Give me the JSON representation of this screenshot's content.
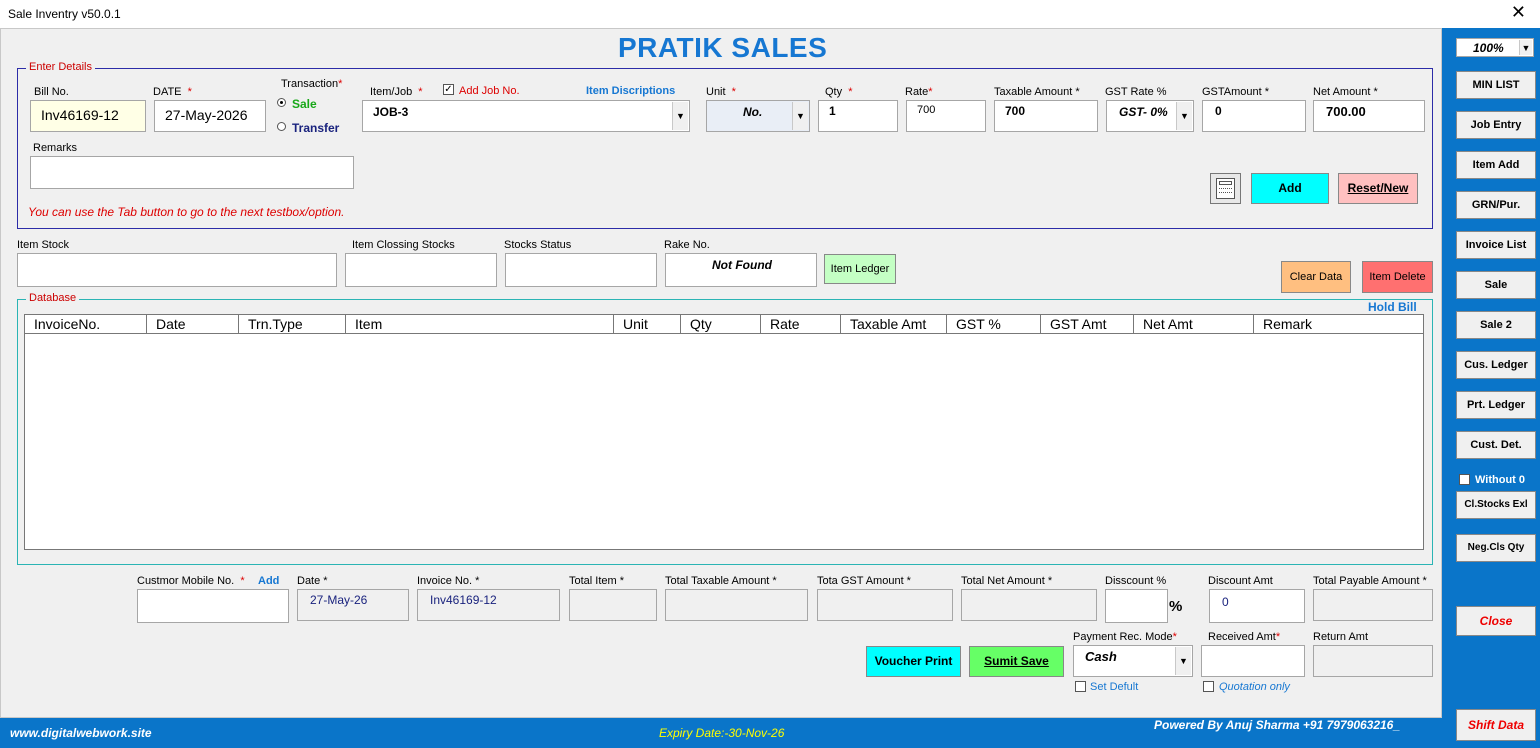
{
  "window": {
    "title": "Sale Inventry v50.0.1",
    "close": "✕"
  },
  "brand": "PRATIK SALES",
  "enter_details": {
    "legend": "Enter Details",
    "bill_no_label": "Bill No.",
    "bill_no": "Inv46169-12",
    "date_label": "DATE",
    "date": "27-May-2026",
    "transaction_label": "Transaction",
    "sale": "Sale",
    "transfer": "Transfer",
    "item_job_label": "Item/Job",
    "add_job_no": "Add Job No.",
    "item_descriptions": "Item Discriptions",
    "item_job_value": "JOB-3",
    "unit_label": "Unit",
    "unit_value": "No.",
    "qty_label": "Qty",
    "qty_value": "1",
    "rate_label": "Rate",
    "rate_value": "700",
    "taxable_label": "Taxable Amount *",
    "taxable_value": "700",
    "gst_rate_label": "GST Rate %",
    "gst_rate_value": "GST- 0%",
    "gst_amount_label": "GSTAmount *",
    "gst_amount_value": "0",
    "net_amount_label": "Net Amount *",
    "net_amount_value": "700.00",
    "remarks_label": "Remarks",
    "hint": "You can use the Tab button to go to the next testbox/option.",
    "add_button": "Add",
    "reset_button": "Reset/New"
  },
  "stock": {
    "item_stock_label": "Item Stock",
    "item_closing_label": "Item Clossing Stocks",
    "stocks_status_label": "Stocks Status",
    "rake_no_label": "Rake No.",
    "rake_no_value": "Not Found",
    "item_ledger_button": "Item Ledger",
    "clear_data_button": "Clear Data",
    "item_delete_button": "Item Delete"
  },
  "database": {
    "legend": "Database",
    "hold_bill": "Hold Bill",
    "columns": [
      "InvoiceNo.",
      "Date",
      "Trn.Type",
      "Item",
      "Unit",
      "Qty",
      "Rate",
      "Taxable  Amt",
      "GST  %",
      "GST Amt",
      "Net Amt",
      "Remark"
    ]
  },
  "summary": {
    "mobile_label": "Custmor Mobile No.",
    "mobile_add": "Add",
    "date_label": "Date *",
    "date_value": "27-May-26",
    "invoice_label": "Invoice No. *",
    "invoice_value": "Inv46169-12",
    "total_item_label": "Total Item *",
    "total_taxable_label": "Total Taxable Amount *",
    "total_gst_label": "Tota GST Amount *",
    "total_net_label": "Total Net Amount *",
    "discount_pct_label": "Disscount %",
    "pct_sign": "%",
    "discount_amt_label": "Discount Amt",
    "discount_amt_value": "0",
    "total_payable_label": "Total Payable Amount *",
    "payment_mode_label": "Payment Rec. Mode",
    "payment_mode_value": "Cash",
    "received_label": "Received Amt",
    "return_label": "Return Amt",
    "set_default": "Set Defult",
    "quotation_only": "Quotation only",
    "voucher_print": "Voucher Print",
    "submit_save": "Sumit Save"
  },
  "sidebar": {
    "zoom": "100%",
    "buttons": [
      "MIN LIST",
      "Job Entry",
      "Item Add",
      "GRN/Pur.",
      "Invoice List",
      "Sale",
      "Sale 2",
      "Cus. Ledger",
      "Prt. Ledger",
      "Cust. Det."
    ],
    "without_zero": "Without 0",
    "cl_stocks": "Cl.Stocks Exl",
    "neg_cls": "Neg.Cls Qty",
    "close": "Close",
    "shift_data": "Shift Data"
  },
  "footer": {
    "website": "www.digitalwebwork.site",
    "expiry": "Expiry Date:-30-Nov-26",
    "powered": "Powered By Anuj Sharma +91 7979063216_"
  }
}
